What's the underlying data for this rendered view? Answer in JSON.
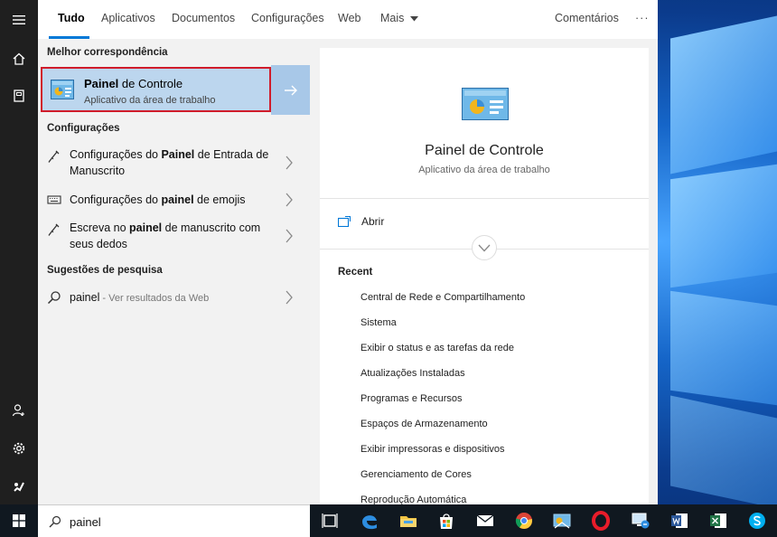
{
  "tabs": [
    {
      "label": "Tudo",
      "active": true
    },
    {
      "label": "Aplicativos"
    },
    {
      "label": "Documentos"
    },
    {
      "label": "Configurações"
    },
    {
      "label": "Web"
    },
    {
      "label": "Mais"
    }
  ],
  "feedback_label": "Comentários",
  "more_options": "···",
  "sections": {
    "best_match": "Melhor correspondência",
    "settings": "Configurações",
    "suggestions": "Sugestões de pesquisa"
  },
  "best_match": {
    "title_bold": "Painel",
    "title_rest": " de Controle",
    "subtitle": "Aplicativo da área de trabalho"
  },
  "settings_items": [
    {
      "pre": "Configurações do ",
      "bold": "Painel",
      "post": " de Entrada de Manuscrito"
    },
    {
      "pre": "Configurações do ",
      "bold": "painel",
      "post": " de emojis"
    },
    {
      "pre": "Escreva no ",
      "bold": "painel",
      "post": " de manuscrito com seus dedos"
    }
  ],
  "suggestion": {
    "query": "painel",
    "note": " - Ver resultados da Web"
  },
  "preview": {
    "title": "Painel de Controle",
    "subtitle": "Aplicativo da área de trabalho",
    "open_label": "Abrir",
    "recent_header": "Recent",
    "recent": [
      "Central de Rede e Compartilhamento",
      "Sistema",
      "Exibir o status e as tarefas da rede",
      "Atualizações Instaladas",
      "Programas e Recursos",
      "Espaços de Armazenamento",
      "Exibir impressoras e dispositivos",
      "Gerenciamento de Cores",
      "Reprodução Automática"
    ]
  },
  "search": {
    "value": "painel"
  },
  "taskbar_icons": [
    "task-view-icon",
    "edge-icon",
    "file-explorer-icon",
    "store-icon",
    "mail-icon",
    "chrome-icon",
    "control-panel-icon",
    "opera-icon",
    "remote-desktop-icon",
    "word-icon",
    "excel-icon",
    "skype-icon"
  ],
  "colors": {
    "accent": "#0078d7",
    "highlight": "#bcd6ee",
    "selection_border": "#d01c2b"
  }
}
